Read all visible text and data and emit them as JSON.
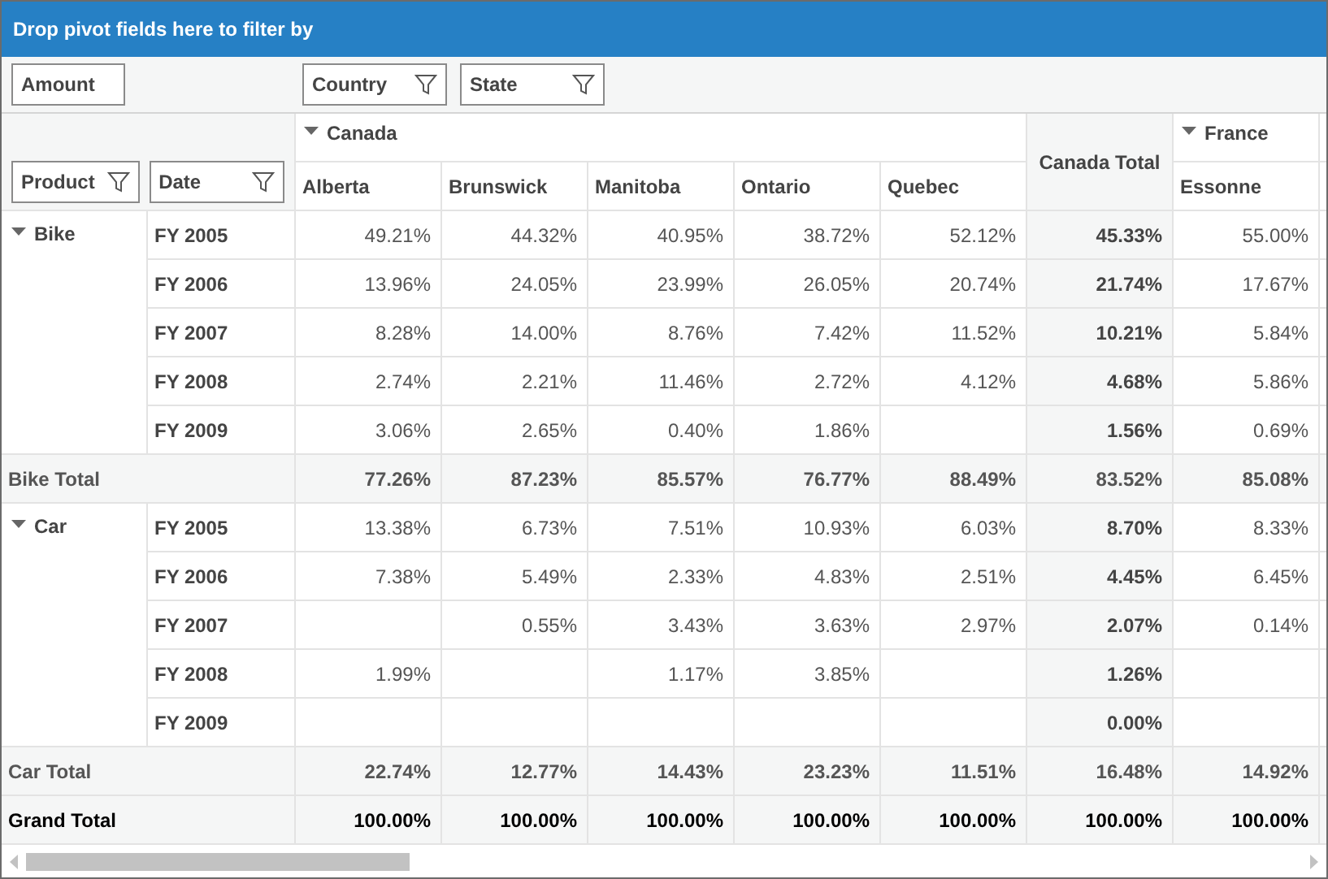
{
  "filter_bar": {
    "title": "Drop pivot fields here to filter by"
  },
  "data_field": {
    "label": "Amount"
  },
  "column_fields": [
    {
      "label": "Country"
    },
    {
      "label": "State"
    }
  ],
  "row_fields": [
    {
      "label": "Product"
    },
    {
      "label": "Date"
    }
  ],
  "countries": [
    {
      "name": "Canada",
      "expanded": true,
      "states": [
        "Alberta",
        "Brunswick",
        "Manitoba",
        "Ontario",
        "Quebec"
      ],
      "total": "Canada Total"
    },
    {
      "name": "France",
      "expanded": true,
      "states": [
        "Essonne"
      ]
    }
  ],
  "groups": [
    {
      "name": "Bike",
      "expanded": true,
      "rows": [
        {
          "label": "FY 2005",
          "cells": [
            {
              "text": "49.21%"
            },
            {
              "text": "44.32%"
            },
            {
              "text": "40.95%"
            },
            {
              "text": "38.72%"
            },
            {
              "text": "52.12%"
            },
            {
              "text": "45.33%"
            },
            {
              "text": "55.00%"
            }
          ]
        },
        {
          "label": "FY 2006",
          "cells": [
            {
              "text": "13.96%"
            },
            {
              "text": "24.05%"
            },
            {
              "text": "23.99%"
            },
            {
              "text": "26.05%"
            },
            {
              "text": "20.74%"
            },
            {
              "text": "21.74%"
            },
            {
              "text": "17.67%"
            }
          ]
        },
        {
          "label": "FY 2007",
          "cells": [
            {
              "text": "8.28%"
            },
            {
              "text": "14.00%"
            },
            {
              "text": "8.76%"
            },
            {
              "text": "7.42%"
            },
            {
              "text": "11.52%"
            },
            {
              "text": "10.21%"
            },
            {
              "text": "5.84%"
            }
          ]
        },
        {
          "label": "FY 2008",
          "cells": [
            {
              "text": "2.74%"
            },
            {
              "text": "2.21%"
            },
            {
              "text": "11.46%"
            },
            {
              "text": "2.72%"
            },
            {
              "text": "4.12%"
            },
            {
              "text": "4.68%"
            },
            {
              "text": "5.86%"
            }
          ]
        },
        {
          "label": "FY 2009",
          "cells": [
            {
              "text": "3.06%"
            },
            {
              "text": "2.65%"
            },
            {
              "text": "0.40%"
            },
            {
              "text": "1.86%"
            },
            {},
            {
              "text": "1.56%"
            },
            {
              "text": "0.69%"
            }
          ]
        }
      ],
      "total": {
        "label": "Bike Total",
        "cells": [
          {
            "text": "77.26%"
          },
          {
            "text": "87.23%"
          },
          {
            "text": "85.57%"
          },
          {
            "text": "76.77%"
          },
          {
            "text": "88.49%"
          },
          {
            "text": "83.52%"
          },
          {
            "text": "85.08%"
          }
        ]
      }
    },
    {
      "name": "Car",
      "expanded": true,
      "rows": [
        {
          "label": "FY 2005",
          "cells": [
            {
              "text": "13.38%"
            },
            {
              "text": "6.73%"
            },
            {
              "text": "7.51%"
            },
            {
              "text": "10.93%"
            },
            {
              "text": "6.03%"
            },
            {
              "text": "8.70%"
            },
            {
              "text": "8.33%"
            }
          ]
        },
        {
          "label": "FY 2006",
          "cells": [
            {
              "text": "7.38%"
            },
            {
              "text": "5.49%"
            },
            {
              "text": "2.33%"
            },
            {
              "text": "4.83%"
            },
            {
              "text": "2.51%"
            },
            {
              "text": "4.45%"
            },
            {
              "text": "6.45%"
            }
          ]
        },
        {
          "label": "FY 2007",
          "cells": [
            {},
            {
              "text": "0.55%"
            },
            {
              "text": "3.43%"
            },
            {
              "text": "3.63%"
            },
            {
              "text": "2.97%"
            },
            {
              "text": "2.07%"
            },
            {
              "text": "0.14%"
            }
          ]
        },
        {
          "label": "FY 2008",
          "cells": [
            {
              "text": "1.99%"
            },
            {},
            {
              "text": "1.17%"
            },
            {
              "text": "3.85%"
            },
            {},
            {
              "text": "1.26%"
            },
            {}
          ]
        },
        {
          "label": "FY 2009",
          "cells": [
            {},
            {},
            {},
            {},
            {},
            {
              "text": "0.00%"
            },
            {}
          ]
        }
      ],
      "total": {
        "label": "Car Total",
        "cells": [
          {
            "text": "22.74%"
          },
          {
            "text": "12.77%"
          },
          {
            "text": "14.43%"
          },
          {
            "text": "23.23%"
          },
          {
            "text": "11.51%"
          },
          {
            "text": "16.48%"
          },
          {
            "text": "14.92%"
          }
        ]
      }
    }
  ],
  "grand_total": {
    "label": "Grand Total",
    "cells": [
      {
        "text": "100.00%"
      },
      {
        "text": "100.00%"
      },
      {
        "text": "100.00%"
      },
      {
        "text": "100.00%"
      },
      {
        "text": "100.00%"
      },
      {
        "text": "100.00%"
      },
      {
        "text": "100.00%"
      }
    ]
  }
}
